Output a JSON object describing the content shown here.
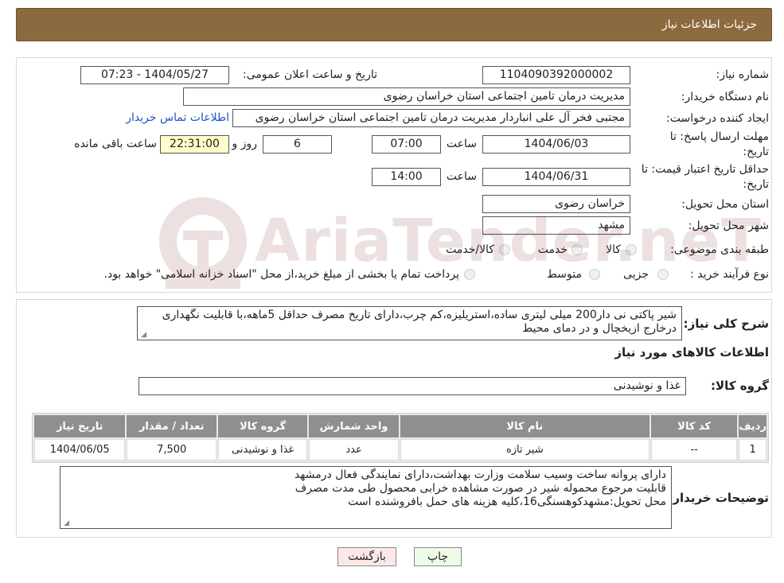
{
  "header": {
    "title": "جزئیات اطلاعات نیاز"
  },
  "form": {
    "need_number_label": "شماره نیاز:",
    "need_number": "1104090392000002",
    "announce_datetime_label": "تاریخ و ساعت اعلان عمومی:",
    "announce_datetime": "1404/05/27 - 07:23",
    "buyer_org_label": "نام دستگاه خریدار:",
    "buyer_org": "مدیریت درمان تامین اجتماعی استان خراسان رضوی",
    "requester_label": "ایجاد کننده درخواست:",
    "requester": "مجتبی فخر آل علی انباردار مدیریت درمان تامین اجتماعی استان خراسان رضوی",
    "contact_link": "اطلاعات تماس خریدار",
    "reply_deadline_label_1": "مهلت ارسال پاسخ: تا",
    "reply_deadline_label_2": "تاریخ:",
    "reply_date": "1404/06/03",
    "time_label": "ساعت",
    "reply_time": "07:00",
    "days_value": "6",
    "days_label": "روز و",
    "remaining_time": "22:31:00",
    "remaining_label": "ساعت باقی مانده",
    "price_validity_label_1": "حداقل تاریخ اعتبار قیمت: تا",
    "price_validity_label_2": "تاریخ:",
    "validity_date": "1404/06/31",
    "validity_time": "14:00",
    "province_label": "استان محل تحویل:",
    "province": "خراسان رضوی",
    "city_label": "شهر محل تحویل:",
    "city": "مشهد",
    "category_label": "طبقه بندی موضوعی:",
    "category_options": [
      "کالا",
      "خدمت",
      "کالا/خدمت"
    ],
    "process_label": "نوع فرآیند خرید :",
    "process_options": [
      "جزیی",
      "متوسط"
    ],
    "process_note": "پرداخت تمام یا بخشی از مبلغ خرید،از محل \"اسناد خزانه اسلامی\" خواهد بود."
  },
  "description": {
    "label": "شرح کلی نیاز:",
    "text": "شیر پاکتی نی دار200 میلی لیتری ساده،استریلیزه،کم چرب،دارای تاریخ مصرف حداقل 5ماهه،با قابلیت نگهداری درخارج ازیخچال و در دمای محیط"
  },
  "goods": {
    "section_title": "اطلاعات کالاهای مورد نیاز",
    "group_label": "گروه کالا:",
    "group_value": "غذا و نوشیدنی",
    "columns": [
      "ردیف",
      "کد کالا",
      "نام کالا",
      "واحد شمارش",
      "گروه کالا",
      "تعداد / مقدار",
      "تاریخ نیاز"
    ],
    "rows": [
      [
        "1",
        "--",
        "شیر تازه",
        "عدد",
        "غذا و نوشیدنی",
        "7,500",
        "1404/06/05"
      ]
    ]
  },
  "buyer_notes": {
    "label": "توضیحات خریدار:",
    "lines": [
      "دارای پروانه ساخت وسیب سلامت وزارت بهداشت،دارای نمایندگی فعال درمشهد",
      "قابلیت مرجوع محموله شیر در صورت مشاهده خرابی محصول طی مدت مصرف",
      "محل تحویل:مشهدکوهسنگی16،کلیه هزینه های حمل بافروشنده است"
    ]
  },
  "buttons": {
    "print": "چاپ",
    "back": "بازگشت"
  },
  "watermark": {
    "text": "AriaTender.neT"
  },
  "colors": {
    "header_bg": "#8c6a3f",
    "link": "#1a55c8",
    "yellow_field": "#ffffcc",
    "table_header": "#8f8f8f"
  }
}
